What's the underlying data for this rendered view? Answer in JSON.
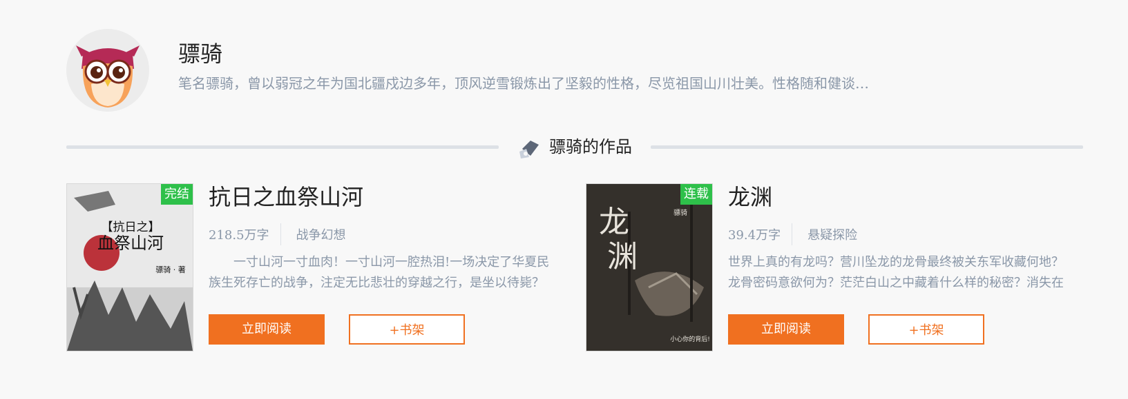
{
  "author": {
    "name": "骠骑",
    "bio": "笔名骠骑，曾以弱冠之年为国北疆戍边多年，顶风逆雪锻炼出了坚毅的性格，尽览祖国山川壮美。性格随和健谈…"
  },
  "section": {
    "title": "骠骑的作品"
  },
  "books": [
    {
      "title": "抗日之血祭山河",
      "status": "完结",
      "word_count": "218.5万字",
      "genre": "战争幻想",
      "intro": "一寸山河一寸血肉！一寸山河一腔热泪!一场决定了华夏民族生死存亡的战争，注定无比悲壮的穿越之行，是坐以待毙？",
      "read_label": "立即阅读",
      "shelf_label": "+书架",
      "cover_text": {
        "title_top": "【抗日之】",
        "title_main": "血祭山河",
        "author": "骠骑 · 著"
      }
    },
    {
      "title": "龙渊",
      "status": "连载",
      "word_count": "39.4万字",
      "genre": "悬疑探险",
      "intro": "世界上真的有龙吗？营川坠龙的龙骨最终被关东军收藏何地？龙骨密码意欲何为？茫茫白山之中藏着什么样的秘密？消失在",
      "read_label": "立即阅读",
      "shelf_label": "+书架",
      "cover_text": {
        "title_main": "龙渊",
        "author": "骠骑",
        "tagline": "小心你的背后!"
      }
    }
  ],
  "colors": {
    "accent": "#f07020",
    "badge_green": "#2ec04a",
    "muted_text": "#8a97a8"
  },
  "icons": {
    "avatar": "owl-avatar-icon",
    "section": "pen-icon"
  }
}
